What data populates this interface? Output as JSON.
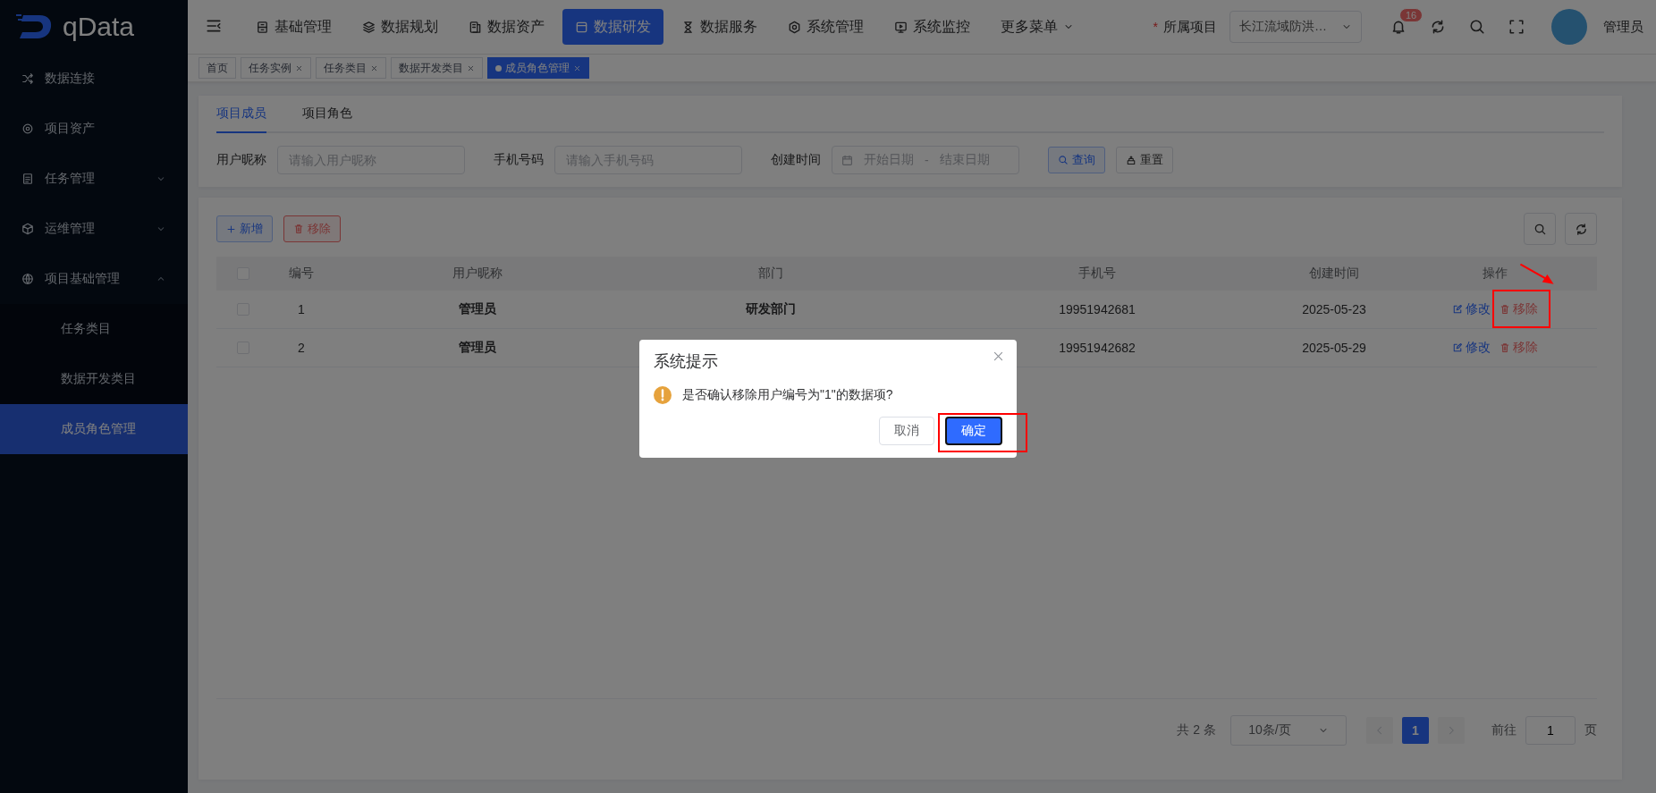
{
  "logo": {
    "text": "qData"
  },
  "sidebar": {
    "items": [
      {
        "label": "数据连接",
        "selected": false
      },
      {
        "label": "项目资产",
        "selected": false
      },
      {
        "label": "任务管理",
        "expanded": false,
        "selected": false
      },
      {
        "label": "运维管理",
        "expanded": false,
        "selected": false
      },
      {
        "label": "项目基础管理",
        "expanded": true,
        "selected": false,
        "children": [
          {
            "label": "任务类目",
            "selected": false
          },
          {
            "label": "数据开发类目",
            "selected": false
          },
          {
            "label": "成员角色管理",
            "selected": true
          }
        ]
      }
    ]
  },
  "topnav": {
    "items": [
      {
        "label": "基础管理",
        "selected": false
      },
      {
        "label": "数据规划",
        "selected": false
      },
      {
        "label": "数据资产",
        "selected": false
      },
      {
        "label": "数据研发",
        "selected": true
      },
      {
        "label": "数据服务",
        "selected": false
      },
      {
        "label": "系统管理",
        "selected": false
      },
      {
        "label": "系统监控",
        "selected": false
      },
      {
        "label": "更多菜单",
        "selected": false
      }
    ],
    "project_required_mark": "*",
    "project_label": "所属项目",
    "project_value": "长江流域防洪…",
    "notification_count": "16",
    "user": "管理员"
  },
  "tags": [
    {
      "label": "首页",
      "closable": false,
      "selected": false
    },
    {
      "label": "任务实例",
      "closable": true,
      "selected": false
    },
    {
      "label": "任务类目",
      "closable": true,
      "selected": false
    },
    {
      "label": "数据开发类目",
      "closable": true,
      "selected": false
    },
    {
      "label": "成员角色管理",
      "closable": true,
      "selected": true
    }
  ],
  "tabs": [
    {
      "label": "项目成员",
      "selected": true
    },
    {
      "label": "项目角色",
      "selected": false
    }
  ],
  "filters": {
    "nickname_label": "用户昵称",
    "nickname_placeholder": "请输入用户昵称",
    "phone_label": "手机号码",
    "phone_placeholder": "请输入手机号码",
    "date_label": "创建时间",
    "date_start": "开始日期",
    "date_sep": "-",
    "date_end": "结束日期",
    "search_button": "查询",
    "reset_button": "重置"
  },
  "toolbar": {
    "add_button": "新增",
    "remove_button": "移除"
  },
  "table": {
    "select_all_checked": false,
    "columns": [
      "编号",
      "用户昵称",
      "部门",
      "手机号",
      "创建时间",
      "操作"
    ],
    "rows": [
      {
        "number": "1",
        "nickname": "管理员",
        "department": "研发部门",
        "phone": "19951942681",
        "created": "2025-05-23",
        "edit_action": "修改",
        "remove_action": "移除",
        "checked": false,
        "highlighted": true
      },
      {
        "number": "2",
        "nickname": "管理员",
        "phone": "19951942682",
        "created": "2025-05-29",
        "edit_action": "修改",
        "remove_action": "移除",
        "checked": false,
        "highlighted": false
      }
    ]
  },
  "pagination": {
    "total": "共 2 条",
    "page_size": "10条/页",
    "current": "1",
    "goto_label": "前往",
    "goto_value": "1",
    "page_suffix": "页"
  },
  "dialog": {
    "title": "系统提示",
    "message": "是否确认移除用户编号为\"1\"的数据项?",
    "cancel": "取消",
    "confirm": "确定",
    "confirm_highlighted": true
  }
}
